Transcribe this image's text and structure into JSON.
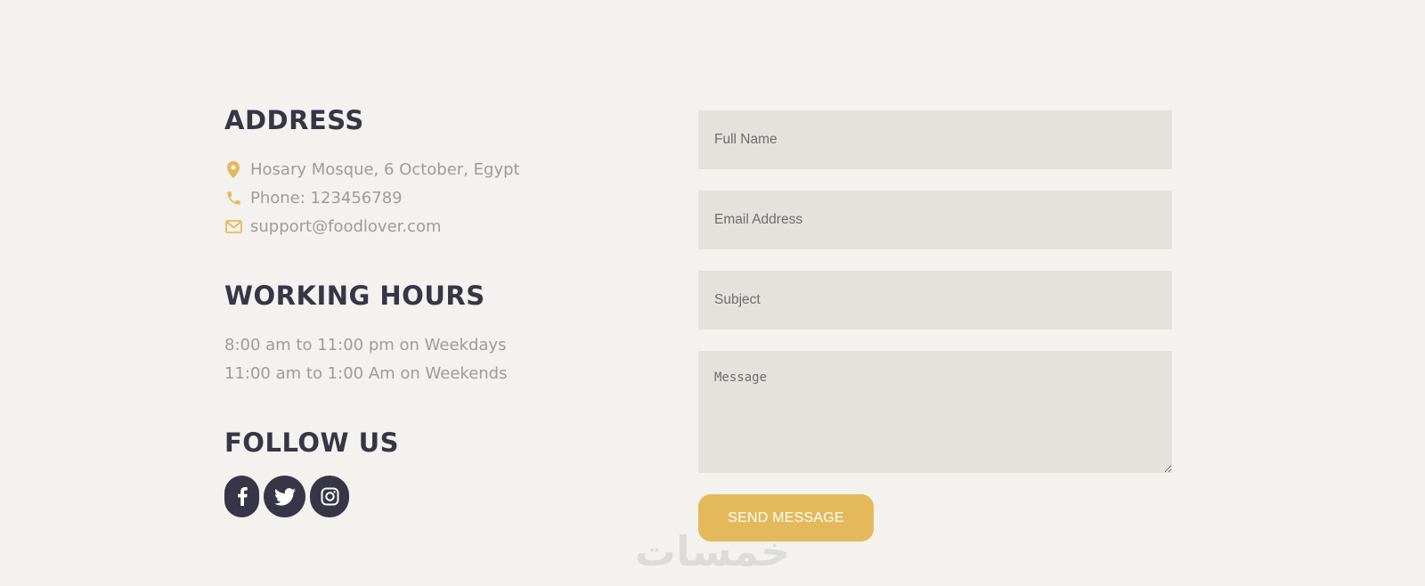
{
  "address": {
    "title": "ADDRESS",
    "items": [
      {
        "icon": "map-pin-icon",
        "text": "Hosary Mosque, 6 October, Egypt"
      },
      {
        "icon": "phone-icon",
        "text": "Phone: 123456789"
      },
      {
        "icon": "envelope-icon",
        "text": "support@foodlover.com"
      }
    ]
  },
  "working_hours": {
    "title": "WORKING HOURS",
    "lines": [
      "8:00 am to 11:00 pm on Weekdays",
      "11:00 am to 1:00 Am on Weekends"
    ]
  },
  "follow": {
    "title": "FOLLOW US",
    "icons": [
      "facebook-icon",
      "twitter-icon",
      "instagram-icon"
    ]
  },
  "form": {
    "full_name_placeholder": "Full Name",
    "email_placeholder": "Email Address",
    "subject_placeholder": "Subject",
    "message_placeholder": "Message",
    "send_label": "SEND MESSAGE"
  },
  "watermark": "خمسات",
  "colors": {
    "background": "#f3f2ee",
    "heading": "#363646",
    "body_text": "#9e9c9c",
    "accent": "#e4b95b",
    "field_bg": "#e3e2dd"
  }
}
